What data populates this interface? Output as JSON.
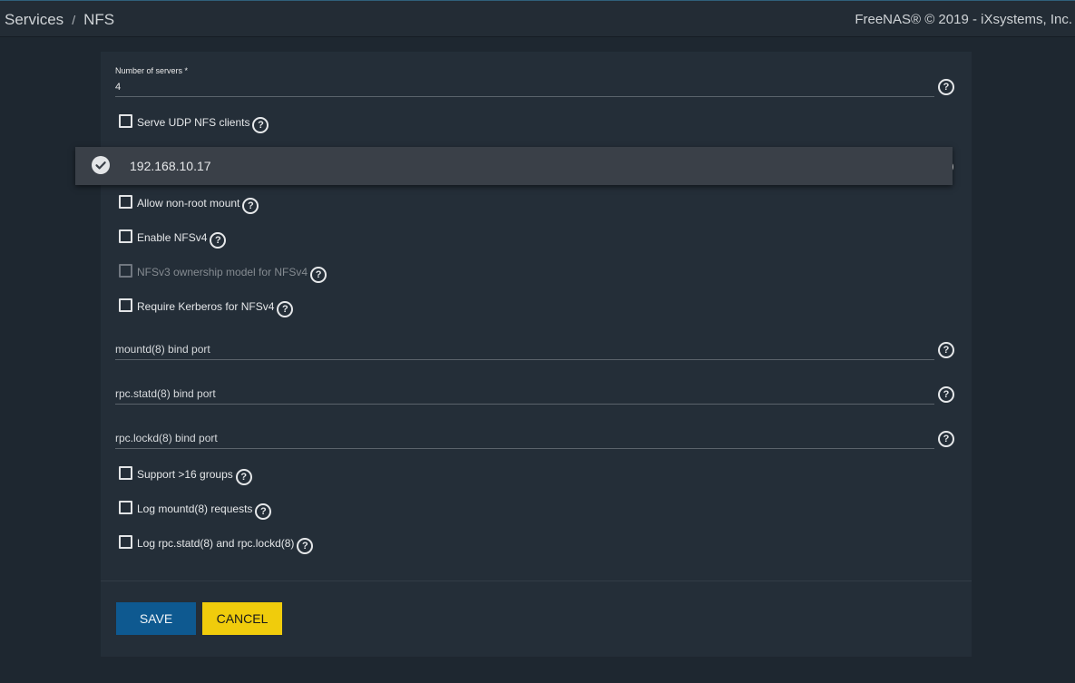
{
  "header": {
    "breadcrumb": [
      "Services",
      "NFS"
    ],
    "separator": "/",
    "copyright": "FreeNAS® © 2019 - iXsystems, Inc."
  },
  "form": {
    "servers": {
      "label": "Number of servers *",
      "value": "4"
    },
    "checkboxes": {
      "udp": "Serve UDP NFS clients",
      "nonroot": "Allow non-root mount",
      "nfsv4": "Enable NFSv4",
      "v3owner": "NFSv3 ownership model for NFSv4",
      "kerberos": "Require Kerberos for NFSv4",
      "groups16": "Support >16 groups",
      "logmountd": "Log mountd(8) requests",
      "logrpc": "Log rpc.statd(8) and rpc.lockd(8)"
    },
    "ports": {
      "mountd": "mountd(8) bind port",
      "statd": "rpc.statd(8) bind port",
      "lockd": "rpc.lockd(8) bind port"
    },
    "help_glyph": "?"
  },
  "dropdown": {
    "selected": "192.168.10.17",
    "icon": "check-circle-icon"
  },
  "buttons": {
    "save": "SAVE",
    "cancel": "CANCEL"
  },
  "colors": {
    "background": "#1e2730",
    "card": "#242e38",
    "save": "#0e5990",
    "cancel": "#f0cc0c",
    "dropdown": "#3a4048"
  }
}
